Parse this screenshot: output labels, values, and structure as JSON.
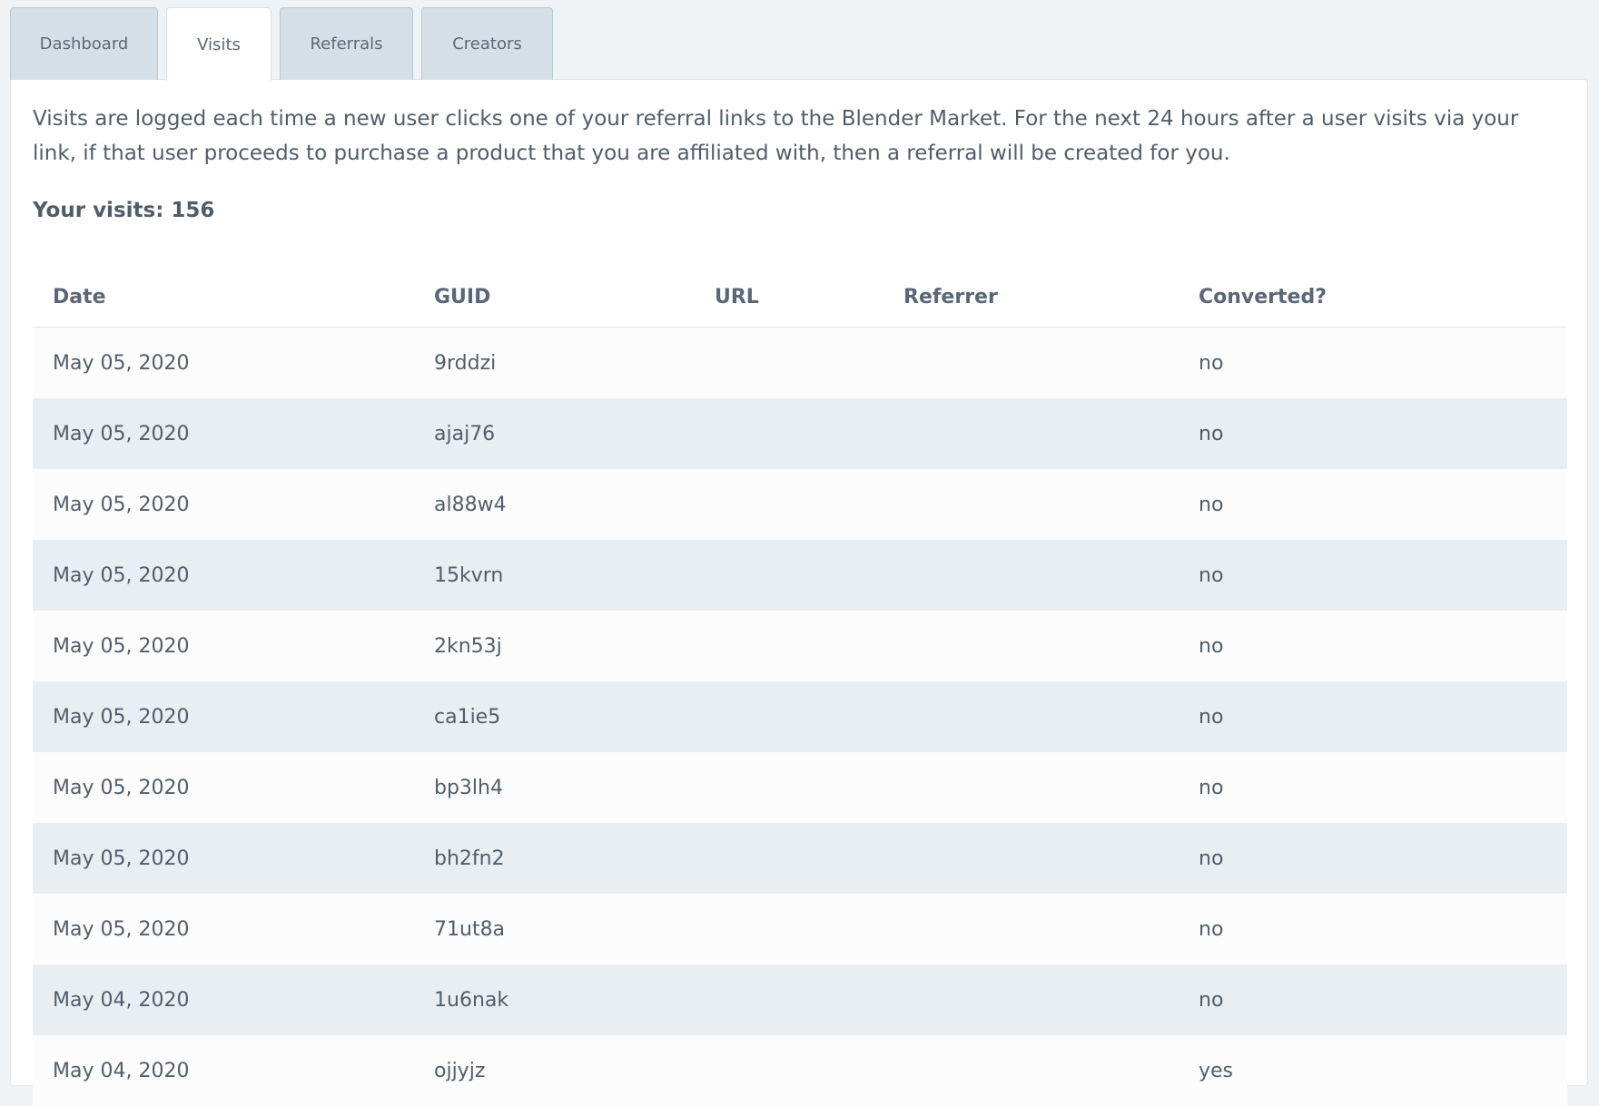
{
  "tabs": [
    {
      "label": "Dashboard",
      "active": false
    },
    {
      "label": "Visits",
      "active": true
    },
    {
      "label": "Referrals",
      "active": false
    },
    {
      "label": "Creators",
      "active": false
    }
  ],
  "intro": "Visits are logged each time a new user clicks one of your referral links to the Blender Market. For the next 24 hours after a user visits via your link, if that user proceeds to purchase a product that you are affiliated with, then a referral will be created for you.",
  "visits_count_line": "Your visits: 156",
  "table": {
    "headers": [
      "Date",
      "GUID",
      "URL",
      "Referrer",
      "Converted?"
    ],
    "rows": [
      [
        "May 05, 2020",
        "9rddzi",
        "",
        "",
        "no"
      ],
      [
        "May 05, 2020",
        "ajaj76",
        "",
        "",
        "no"
      ],
      [
        "May 05, 2020",
        "al88w4",
        "",
        "",
        "no"
      ],
      [
        "May 05, 2020",
        "15kvrn",
        "",
        "",
        "no"
      ],
      [
        "May 05, 2020",
        "2kn53j",
        "",
        "",
        "no"
      ],
      [
        "May 05, 2020",
        "ca1ie5",
        "",
        "",
        "no"
      ],
      [
        "May 05, 2020",
        "bp3lh4",
        "",
        "",
        "no"
      ],
      [
        "May 05, 2020",
        "bh2fn2",
        "",
        "",
        "no"
      ],
      [
        "May 05, 2020",
        "71ut8a",
        "",
        "",
        "no"
      ],
      [
        "May 04, 2020",
        "1u6nak",
        "",
        "",
        "no"
      ],
      [
        "May 04, 2020",
        "ojjyjz",
        "",
        "",
        "yes"
      ]
    ]
  }
}
